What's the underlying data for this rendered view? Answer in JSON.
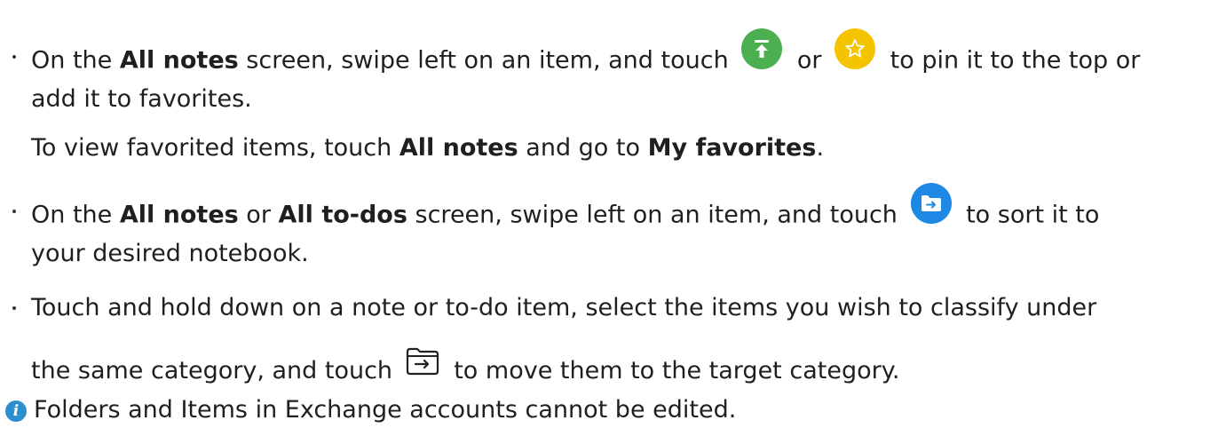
{
  "items": [
    {
      "line1": {
        "t1": "On the ",
        "b1": "All notes",
        "t2": " screen, swipe left on an item, and touch ",
        "t3": " or ",
        "t4": " to pin it to the top or"
      },
      "line2": "add it to favorites.",
      "line3": {
        "t1": "To view favorited items, touch ",
        "b1": "All notes",
        "t2": " and go to ",
        "b2": "My favorites",
        "t3": "."
      }
    },
    {
      "line1": {
        "t1": "On the ",
        "b1": "All notes",
        "t2": " or ",
        "b2": "All to-dos",
        "t3": " screen, swipe left on an item, and touch ",
        "t4": " to sort it to"
      },
      "line2": "your desired notebook."
    },
    {
      "line1": "Touch and hold down on a note or to-do item, select the items you wish to classify under",
      "line2": {
        "t1": "the same category, and touch ",
        "t2": " to move them to the target category."
      }
    }
  ],
  "note": "Folders and Items in Exchange accounts cannot be edited.",
  "icons": {
    "pin": "pin-to-top-icon",
    "favorite": "favorite-star-icon",
    "sort": "move-to-notebook-icon",
    "move": "move-to-category-icon",
    "info": "info-icon"
  },
  "colors": {
    "pin": "#4caf50",
    "favorite": "#f5c400",
    "sort": "#1e88e5",
    "info": "#2e8fcf"
  }
}
